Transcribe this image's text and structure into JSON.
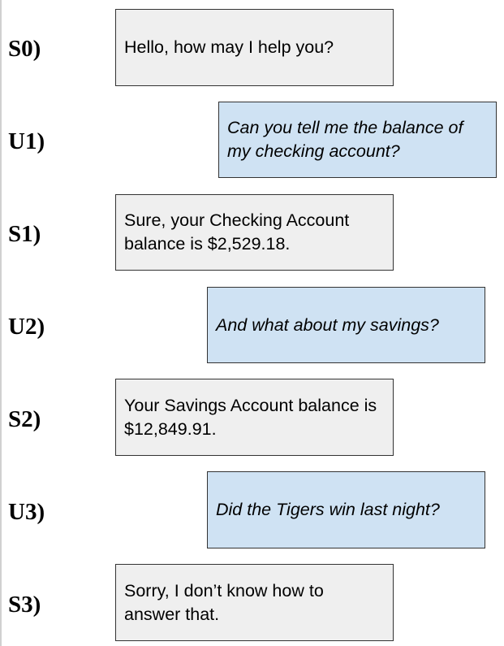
{
  "colors": {
    "system_bubble": "#efefef",
    "user_bubble": "#cfe2f3",
    "border": "#333333"
  },
  "turns": [
    {
      "label": "S0)",
      "speaker": "system",
      "text": "Hello, how may I help you?"
    },
    {
      "label": "U1)",
      "speaker": "user",
      "text": "Can you tell me the balance of my checking account?"
    },
    {
      "label": "S1)",
      "speaker": "system",
      "text": "Sure, your Checking Account balance is $2,529.18."
    },
    {
      "label": "U2)",
      "speaker": "user",
      "text": "And what about my savings?"
    },
    {
      "label": "S2)",
      "speaker": "system",
      "text": "Your Savings Account balance is $12,849.91."
    },
    {
      "label": "U3)",
      "speaker": "user",
      "text": "Did the Tigers win last night?"
    },
    {
      "label": "S3)",
      "speaker": "system",
      "text": "Sorry, I don’t know how to answer that."
    }
  ]
}
